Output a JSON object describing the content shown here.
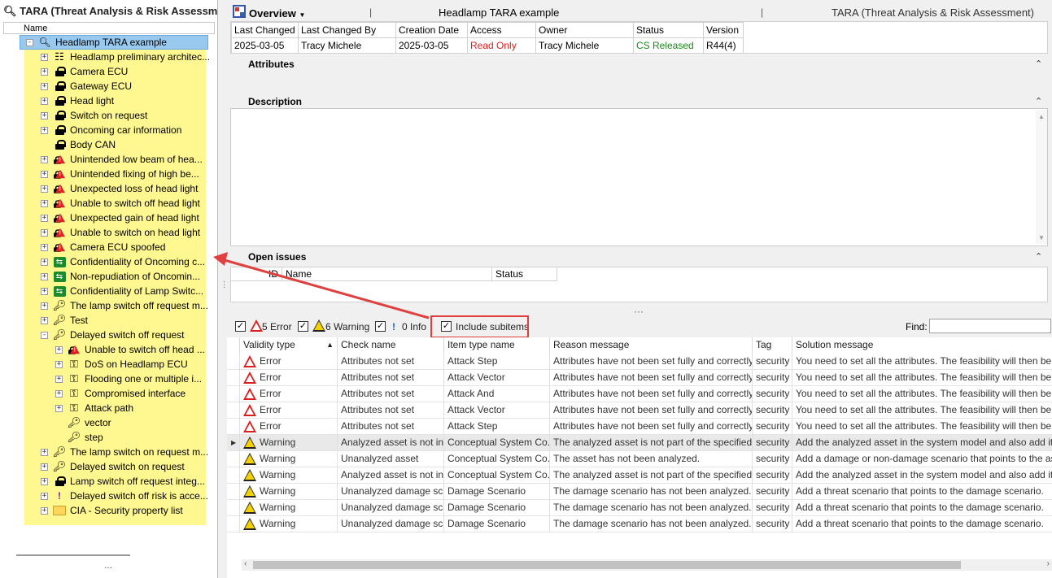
{
  "left_panel": {
    "title": "TARA (Threat Analysis & Risk Assessm",
    "column_header": "Name",
    "root": "Headlamp TARA example",
    "items": [
      {
        "label": "Headlamp preliminary architec...",
        "icon": "architecture-icon",
        "exp": "+",
        "indent": 1
      },
      {
        "label": "Camera ECU",
        "icon": "lock-icon",
        "exp": "+",
        "indent": 1
      },
      {
        "label": "Gateway ECU",
        "icon": "lock-icon",
        "exp": "+",
        "indent": 1
      },
      {
        "label": "Head light",
        "icon": "lock-icon",
        "exp": "+",
        "indent": 1
      },
      {
        "label": "Switch on request",
        "icon": "lock-icon",
        "exp": "+",
        "indent": 1
      },
      {
        "label": "Oncoming car information",
        "icon": "lock-icon",
        "exp": "+",
        "indent": 1
      },
      {
        "label": "Body CAN",
        "icon": "lock-icon",
        "exp": "",
        "indent": 1
      },
      {
        "label": "Unintended low beam of hea...",
        "icon": "damage-warning-icon",
        "exp": "+",
        "indent": 1
      },
      {
        "label": "Unintended fixing of high be...",
        "icon": "damage-warning-icon",
        "exp": "+",
        "indent": 1
      },
      {
        "label": "Unexpected loss of head light",
        "icon": "damage-warning-icon",
        "exp": "+",
        "indent": 1
      },
      {
        "label": "Unable to switch off head light",
        "icon": "damage-warning-icon",
        "exp": "+",
        "indent": 1
      },
      {
        "label": "Unexpected gain of head light",
        "icon": "damage-warning-icon",
        "exp": "+",
        "indent": 1
      },
      {
        "label": "Unable to switch on head light",
        "icon": "damage-warning-icon",
        "exp": "+",
        "indent": 1
      },
      {
        "label": "Camera ECU spoofed",
        "icon": "damage-warning-icon",
        "exp": "+",
        "indent": 1
      },
      {
        "label": "Confidentiality of Oncoming c...",
        "icon": "security-property-icon",
        "exp": "+",
        "indent": 1
      },
      {
        "label": "Non-repudiation of Oncomin...",
        "icon": "security-property-icon",
        "exp": "+",
        "indent": 1
      },
      {
        "label": "Confidentiality of Lamp Switc...",
        "icon": "security-property-icon",
        "exp": "+",
        "indent": 1
      },
      {
        "label": "The lamp switch off request m...",
        "icon": "threat-key-icon",
        "exp": "+",
        "indent": 1
      },
      {
        "label": "Test",
        "icon": "threat-key-icon",
        "exp": "+",
        "indent": 1
      },
      {
        "label": "Delayed switch off request",
        "icon": "threat-key-icon",
        "exp": "-",
        "indent": 1
      },
      {
        "label": "Unable to switch off head ...",
        "icon": "damage-warning-icon",
        "exp": "+",
        "indent": 2
      },
      {
        "label": "DoS on Headlamp ECU",
        "icon": "attack-tree-icon",
        "exp": "+",
        "indent": 2
      },
      {
        "label": "Flooding one or multiple i...",
        "icon": "attack-tree-icon",
        "exp": "+",
        "indent": 2
      },
      {
        "label": "Compromised interface",
        "icon": "attack-tree-icon",
        "exp": "+",
        "indent": 2
      },
      {
        "label": "Attack path",
        "icon": "attack-tree-icon",
        "exp": "+",
        "indent": 2
      },
      {
        "label": "vector",
        "icon": "attack-step-icon",
        "exp": "",
        "indent": 2
      },
      {
        "label": "step",
        "icon": "attack-step-icon",
        "exp": "",
        "indent": 2
      },
      {
        "label": "The lamp switch on request m...",
        "icon": "threat-key-icon",
        "exp": "+",
        "indent": 1
      },
      {
        "label": "Delayed switch on request",
        "icon": "threat-key-icon",
        "exp": "+",
        "indent": 1
      },
      {
        "label": "Lamp switch off request integ...",
        "icon": "lock-icon",
        "exp": "+",
        "indent": 1
      },
      {
        "label": "Delayed switch off risk is acce...",
        "icon": "risk-icon",
        "exp": "+",
        "indent": 1
      },
      {
        "label": "CIA - Security property list",
        "icon": "folder-icon",
        "exp": "+",
        "indent": 1
      }
    ],
    "footer_dots": "..."
  },
  "overview": {
    "title": "Overview",
    "sep": "|",
    "name": "Headlamp TARA example",
    "type": "TARA (Threat Analysis & Risk Assessment)",
    "headers": [
      "Last Changed",
      "Last Changed By",
      "Creation Date",
      "Access",
      "Owner",
      "Status",
      "Version"
    ],
    "values": [
      "2025-03-05",
      "Tracy Michele",
      "2025-03-05",
      "Read Only",
      "Tracy Michele",
      "CS Released",
      "R44(4)"
    ],
    "colors": {
      "access": "#e02020",
      "status": "#1a8a1a"
    }
  },
  "sections": {
    "attributes": "Attributes",
    "description": "Description",
    "open_issues": "Open issues",
    "issues_columns": [
      "ID",
      "Name",
      "Status"
    ]
  },
  "filters": {
    "error": "5 Error",
    "warning": "6 Warning",
    "info": "0 Info",
    "include": "Include subitems",
    "find": "Find:"
  },
  "grid": {
    "columns": [
      "Validity type",
      "Check name",
      "Item type name",
      "Reason message",
      "Tag",
      "Solution message"
    ],
    "rows": [
      {
        "type": "error",
        "validity": "Error",
        "check": "Attributes not set",
        "item": "Attack Step",
        "reason": "Attributes have not been set fully and correctly.",
        "tag": "security",
        "solution": "You need to set all the attributes. The feasibility will then be auto"
      },
      {
        "type": "error",
        "validity": "Error",
        "check": "Attributes not set",
        "item": "Attack Vector",
        "reason": "Attributes have not been set fully and correctly.",
        "tag": "security",
        "solution": "You need to set all the attributes. The feasibility will then be auto"
      },
      {
        "type": "error",
        "validity": "Error",
        "check": "Attributes not set",
        "item": "Attack And",
        "reason": "Attributes have not been set fully and correctly.",
        "tag": "security",
        "solution": "You need to set all the attributes. The feasibility will then be auto"
      },
      {
        "type": "error",
        "validity": "Error",
        "check": "Attributes not set",
        "item": "Attack Vector",
        "reason": "Attributes have not been set fully and correctly.",
        "tag": "security",
        "solution": "You need to set all the attributes. The feasibility will then be auto"
      },
      {
        "type": "error",
        "validity": "Error",
        "check": "Attributes not set",
        "item": "Attack Step",
        "reason": "Attributes have not been set fully and correctly.",
        "tag": "security",
        "solution": "You need to set all the attributes. The feasibility will then be auto"
      },
      {
        "type": "warning",
        "validity": "Warning",
        "check": "Analyzed asset is not in...",
        "item": "Conceptual System Co...",
        "reason": "The analyzed asset is not part of the specified a...",
        "tag": "security",
        "solution": "Add the analyzed asset in the system model and also add it as a"
      },
      {
        "type": "warning",
        "validity": "Warning",
        "check": "Unanalyzed asset",
        "item": "Conceptual System Co...",
        "reason": "The asset has not been analyzed.",
        "tag": "security",
        "solution": "Add a damage or non-damage scenario that points to the asset."
      },
      {
        "type": "warning",
        "validity": "Warning",
        "check": "Analyzed asset is not in...",
        "item": "Conceptual System Co...",
        "reason": "The analyzed asset is not part of the specified a...",
        "tag": "security",
        "solution": "Add the analyzed asset in the system model and also add it as a"
      },
      {
        "type": "warning",
        "validity": "Warning",
        "check": "Unanalyzed damage sc...",
        "item": "Damage Scenario",
        "reason": "The damage scenario has not been analyzed.",
        "tag": "security",
        "solution": "Add a threat scenario that points to the damage scenario."
      },
      {
        "type": "warning",
        "validity": "Warning",
        "check": "Unanalyzed damage sc...",
        "item": "Damage Scenario",
        "reason": "The damage scenario has not been analyzed.",
        "tag": "security",
        "solution": "Add a threat scenario that points to the damage scenario."
      },
      {
        "type": "warning",
        "validity": "Warning",
        "check": "Unanalyzed damage sc...",
        "item": "Damage Scenario",
        "reason": "The damage scenario has not been analyzed.",
        "tag": "security",
        "solution": "Add a threat scenario that points to the damage scenario."
      }
    ]
  }
}
